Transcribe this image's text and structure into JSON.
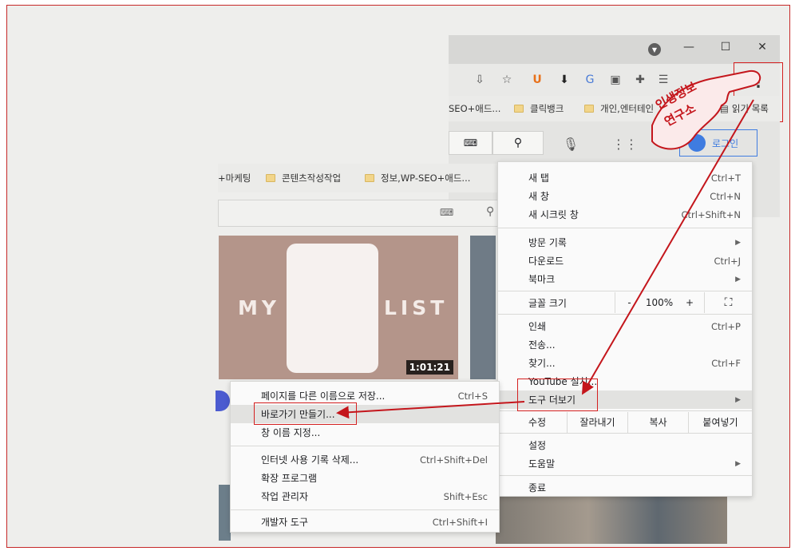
{
  "window": {
    "minimize_label": "—",
    "maximize_label": "☐",
    "close_label": "✕"
  },
  "bookmarks_top": [
    {
      "label": "SEO+애드..."
    },
    {
      "label": "클릭뱅크"
    },
    {
      "label": "개인,엔터테인"
    }
  ],
  "reading_list": "읽기 목록",
  "login_button": "로그인",
  "bookmarks_bottom": [
    {
      "label": "+마케팅"
    },
    {
      "label": "콘텐츠작성작업"
    },
    {
      "label": "정보,WP-SEO+애드..."
    }
  ],
  "video": {
    "title_left": "MY",
    "title_right": "LIST",
    "duration": "1:01:21"
  },
  "chrome_menu": {
    "new_tab": {
      "label": "새 탭",
      "shortcut": "Ctrl+T"
    },
    "new_window": {
      "label": "새 창",
      "shortcut": "Ctrl+N"
    },
    "incognito": {
      "label": "새 시크릿 창",
      "shortcut": "Ctrl+Shift+N"
    },
    "history": {
      "label": "방문 기록"
    },
    "downloads": {
      "label": "다운로드",
      "shortcut": "Ctrl+J"
    },
    "bookmarks": {
      "label": "북마크"
    },
    "zoom": {
      "label": "글꼴 크기",
      "minus": "-",
      "value": "100%",
      "plus": "+"
    },
    "print": {
      "label": "인쇄",
      "shortcut": "Ctrl+P"
    },
    "cast": {
      "label": "전송..."
    },
    "find": {
      "label": "찾기...",
      "shortcut": "Ctrl+F"
    },
    "install_youtube": {
      "label": "YouTube 설치..."
    },
    "more_tools": {
      "label": "도구 더보기"
    },
    "edit": {
      "label": "수정",
      "cut": "잘라내기",
      "copy": "복사",
      "paste": "붙여넣기"
    },
    "settings": {
      "label": "설정"
    },
    "help": {
      "label": "도움말"
    },
    "exit": {
      "label": "종료"
    }
  },
  "more_tools_menu": {
    "save_page": {
      "label": "페이지를 다른 이름으로 저장...",
      "shortcut": "Ctrl+S"
    },
    "create_shortcut": {
      "label": "바로가기 만들기..."
    },
    "name_window": {
      "label": "창 이름 지정..."
    },
    "clear_data": {
      "label": "인터넷 사용 기록 삭제...",
      "shortcut": "Ctrl+Shift+Del"
    },
    "extensions": {
      "label": "확장 프로그램"
    },
    "task_manager": {
      "label": "작업 관리자",
      "shortcut": "Shift+Esc"
    },
    "dev_tools": {
      "label": "개발자 도구",
      "shortcut": "Ctrl+Shift+I"
    }
  },
  "watermark": {
    "line1": "인생정보",
    "line2": "연구소"
  },
  "colors": {
    "annotation": "#c4161c",
    "menu_bg": "#fafafa",
    "highlight": "#e2e2e0"
  }
}
